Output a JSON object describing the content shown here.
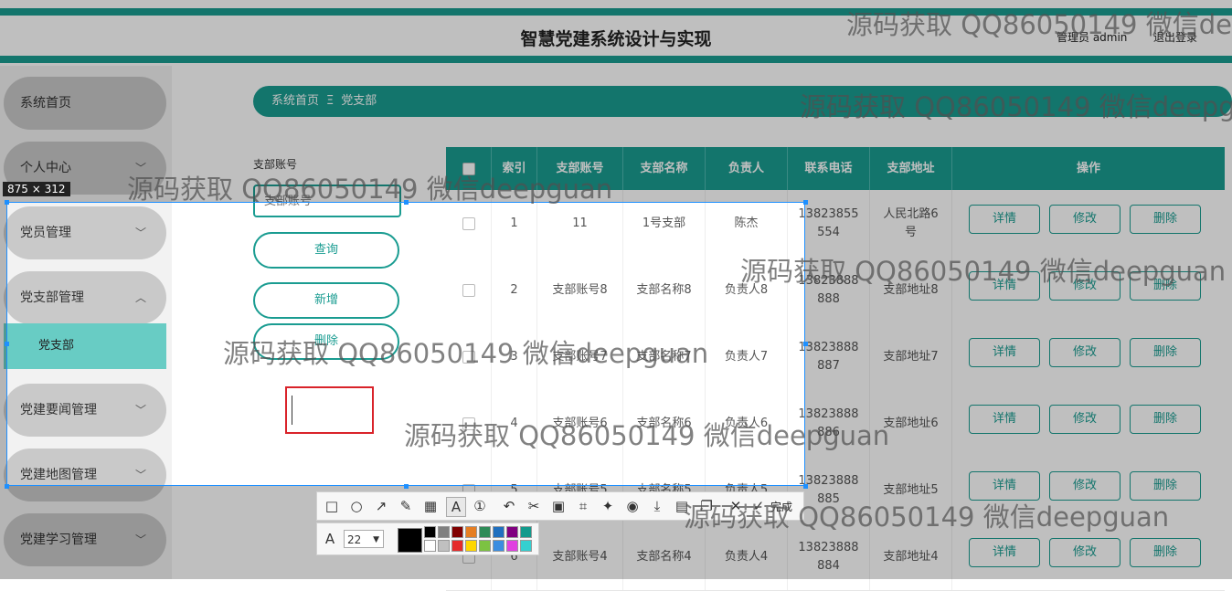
{
  "header": {
    "title": "智慧党建系统设计与实现",
    "user": "管理员 admin",
    "logout": "退出登录"
  },
  "sidebar": {
    "items": [
      {
        "label": "系统首页"
      },
      {
        "label": "个人中心"
      },
      {
        "label": "党员管理"
      },
      {
        "label": "党支部管理"
      },
      {
        "label": "党建要闻管理"
      },
      {
        "label": "党建地图管理"
      },
      {
        "label": "党建学习管理"
      }
    ],
    "sub_item": "党支部"
  },
  "breadcrumb": {
    "home": "系统首页",
    "sep": "Ξ",
    "current": "党支部"
  },
  "search": {
    "label": "支部账号",
    "placeholder": "支部账号",
    "query": "查询",
    "add": "新增",
    "delete": "删除"
  },
  "table": {
    "headers": [
      "索引",
      "支部账号",
      "支部名称",
      "负责人",
      "联系电话",
      "支部地址",
      "操作"
    ],
    "actions": {
      "detail": "详情",
      "edit": "修改",
      "delete": "删除"
    },
    "rows": [
      {
        "idx": "1",
        "account": "11",
        "name": "1号支部",
        "leader": "陈杰",
        "phone1": "13823855",
        "phone2": "554",
        "addr1": "人民北路6",
        "addr2": "号"
      },
      {
        "idx": "2",
        "account": "支部账号8",
        "name": "支部名称8",
        "leader": "负责人8",
        "phone1": "13823888",
        "phone2": "888",
        "addr1": "支部地址8",
        "addr2": ""
      },
      {
        "idx": "3",
        "account": "支部账号7",
        "name": "支部名称7",
        "leader": "负责人7",
        "phone1": "13823888",
        "phone2": "887",
        "addr1": "支部地址7",
        "addr2": ""
      },
      {
        "idx": "4",
        "account": "支部账号6",
        "name": "支部名称6",
        "leader": "负责人6",
        "phone1": "13823888",
        "phone2": "886",
        "addr1": "支部地址6",
        "addr2": ""
      },
      {
        "idx": "5",
        "account": "支部账号5",
        "name": "支部名称5",
        "leader": "负责人5",
        "phone1": "13823888",
        "phone2": "885",
        "addr1": "支部地址5",
        "addr2": ""
      },
      {
        "idx": "6",
        "account": "支部账号4",
        "name": "支部名称4",
        "leader": "负责人4",
        "phone1": "13823888",
        "phone2": "884",
        "addr1": "支部地址4",
        "addr2": ""
      }
    ]
  },
  "screenshot_tool": {
    "size_label": "875 × 312",
    "done": "完成",
    "font_size": "22",
    "colors": [
      "#000000",
      "#808080",
      "#800000",
      "#e67e22",
      "#2e8b57",
      "#1f6fbf",
      "#800080",
      "#139a8c",
      "#ffffff",
      "#c0c0c0",
      "#e52b2b",
      "#ffd700",
      "#7cc242",
      "#3b8de0",
      "#e040e0",
      "#35d0d0"
    ]
  },
  "watermark": "源码获取 QQ86050149 微信deepguan",
  "watermark_top": "源码获取 QQ86050149 微信de",
  "watermark_crumb": "源码获取 QQ86050149 微信deepg"
}
